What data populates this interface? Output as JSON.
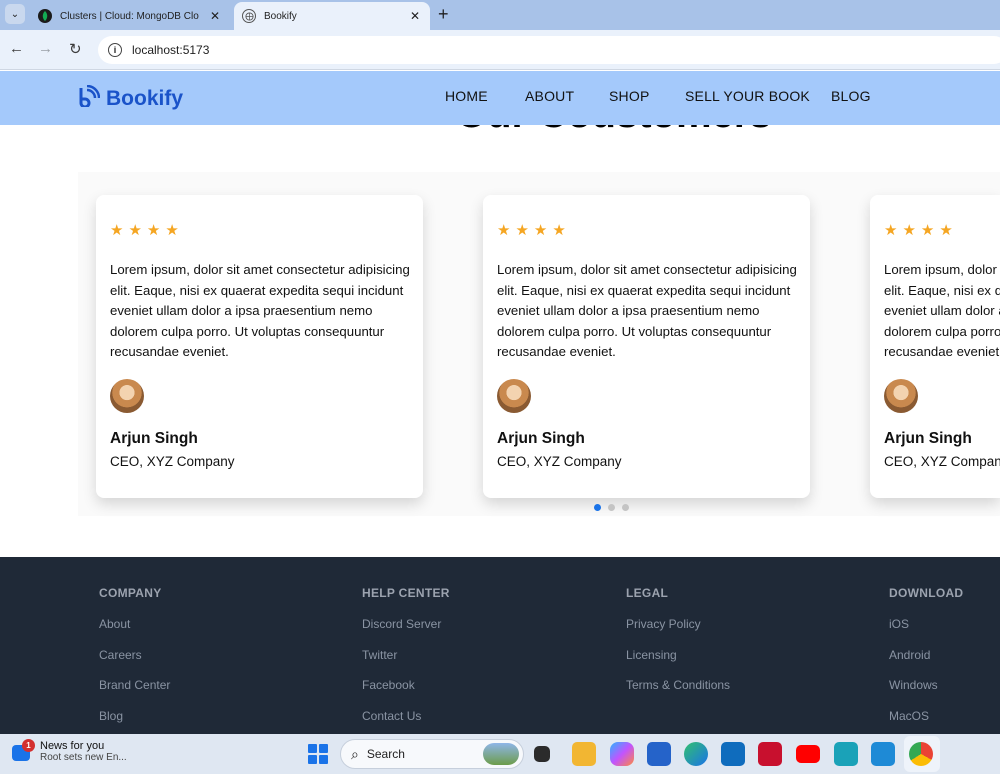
{
  "browser": {
    "tabs": [
      {
        "title": "Clusters | Cloud: MongoDB Clo",
        "active": false,
        "icon": "mongodb-leaf-icon"
      },
      {
        "title": "Bookify",
        "active": true,
        "icon": "globe-icon"
      }
    ],
    "url": "localhost:5173"
  },
  "header": {
    "brand": "Bookify",
    "nav": [
      "HOME",
      "ABOUT",
      "SHOP",
      "SELL YOUR BOOK",
      "BLOG"
    ]
  },
  "testimonials": {
    "heading": "Our Coustomers",
    "cards": [
      {
        "stars": "★★★★",
        "text": "Lorem ipsum, dolor sit amet consectetur adipisicing elit. Eaque, nisi ex quaerat expedita sequi incidunt eveniet ullam dolor a ipsa praesentium nemo dolorem culpa porro. Ut voluptas consequuntur recusandae eveniet.",
        "name": "Arjun Singh",
        "role": "CEO, XYZ Company"
      },
      {
        "stars": "★★★★",
        "text": "Lorem ipsum, dolor sit amet consectetur adipisicing elit. Eaque, nisi ex quaerat expedita sequi incidunt eveniet ullam dolor a ipsa praesentium nemo dolorem culpa porro. Ut voluptas consequuntur recusandae eveniet.",
        "name": "Arjun Singh",
        "role": "CEO, XYZ Company"
      },
      {
        "stars": "★★★★",
        "text": "Lorem ipsum, dolor sit amet consectetur adipisicing elit. Eaque, nisi ex quaerat expedita sequi incidunt eveniet ullam dolor a ipsa praesentium nemo dolorem culpa porro. Ut voluptas consequuntur recusandae eveniet.",
        "name": "Arjun Singh",
        "role": "CEO, XYZ Company"
      }
    ],
    "active_dot": 0
  },
  "footer": {
    "columns": [
      {
        "title": "COMPANY",
        "links": [
          "About",
          "Careers",
          "Brand Center",
          "Blog"
        ]
      },
      {
        "title": "HELP CENTER",
        "links": [
          "Discord Server",
          "Twitter",
          "Facebook",
          "Contact Us"
        ]
      },
      {
        "title": "LEGAL",
        "links": [
          "Privacy Policy",
          "Licensing",
          "Terms & Conditions"
        ]
      },
      {
        "title": "DOWNLOAD",
        "links": [
          "iOS",
          "Android",
          "Windows",
          "MacOS"
        ]
      }
    ]
  },
  "taskbar": {
    "news_title": "News for you",
    "news_subtitle": "Root sets new En...",
    "news_badge": "1",
    "search_label": "Search",
    "icons": [
      "task-view-icon",
      "file-explorer-icon",
      "copilot-icon",
      "microsoft-store-icon",
      "edge-icon",
      "outlook-icon",
      "mcafee-icon",
      "youtube-icon",
      "app-icon",
      "vscode-icon",
      "chrome-icon"
    ]
  },
  "colors": {
    "header_bg": "#a4c9fb",
    "brand": "#1a53c9",
    "star": "#f5a623",
    "footer_bg": "#1f2937",
    "dot_active": "#1a73e8"
  }
}
